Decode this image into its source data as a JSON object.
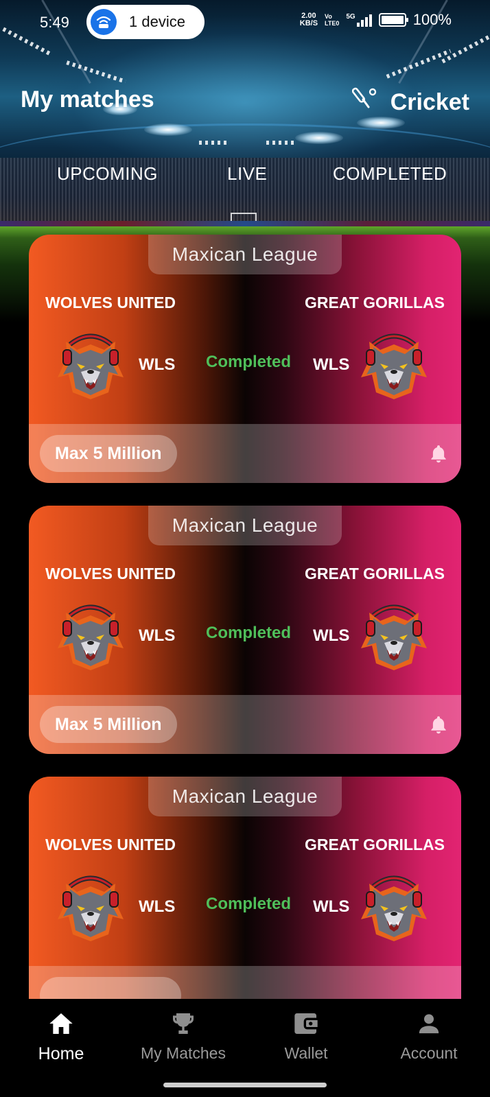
{
  "status_bar": {
    "time": "5:49",
    "device_pill": "1 device",
    "net_speed_value": "2.00",
    "net_speed_unit": "KB/S",
    "volte_top": "Vo",
    "volte_bottom": "LTE0",
    "network": "5G",
    "battery": "100%",
    "accent_color": "#1a73e8"
  },
  "header": {
    "title": "My matches",
    "sport": "Cricket",
    "sport_icon": "cricket-bat-icon"
  },
  "tabs": [
    {
      "label": "UPCOMING"
    },
    {
      "label": "LIVE"
    },
    {
      "label": "COMPLETED"
    }
  ],
  "matches": [
    {
      "league": "Maxican League",
      "team_left": {
        "name": "WOLVES UNITED",
        "abbr": "WLS"
      },
      "team_right": {
        "name": "GREAT GORILLAS",
        "abbr": "WLS"
      },
      "status": "Completed",
      "prize": "Max 5 Million"
    },
    {
      "league": "Maxican League",
      "team_left": {
        "name": "WOLVES UNITED",
        "abbr": "WLS"
      },
      "team_right": {
        "name": "GREAT GORILLAS",
        "abbr": "WLS"
      },
      "status": "Completed",
      "prize": "Max 5 Million"
    },
    {
      "league": "Maxican League",
      "team_left": {
        "name": "WOLVES UNITED",
        "abbr": "WLS"
      },
      "team_right": {
        "name": "GREAT GORILLAS",
        "abbr": "WLS"
      },
      "status": "Completed",
      "prize": ""
    }
  ],
  "colors": {
    "status_completed": "#4fbf5a",
    "card_left": "#f25a22",
    "card_right": "#e22472"
  },
  "bottom_nav": [
    {
      "label": "Home",
      "icon": "home-icon",
      "active": true
    },
    {
      "label": "My Matches",
      "icon": "trophy-icon",
      "active": false
    },
    {
      "label": "Wallet",
      "icon": "wallet-icon",
      "active": false
    },
    {
      "label": "Account",
      "icon": "person-icon",
      "active": false
    }
  ]
}
